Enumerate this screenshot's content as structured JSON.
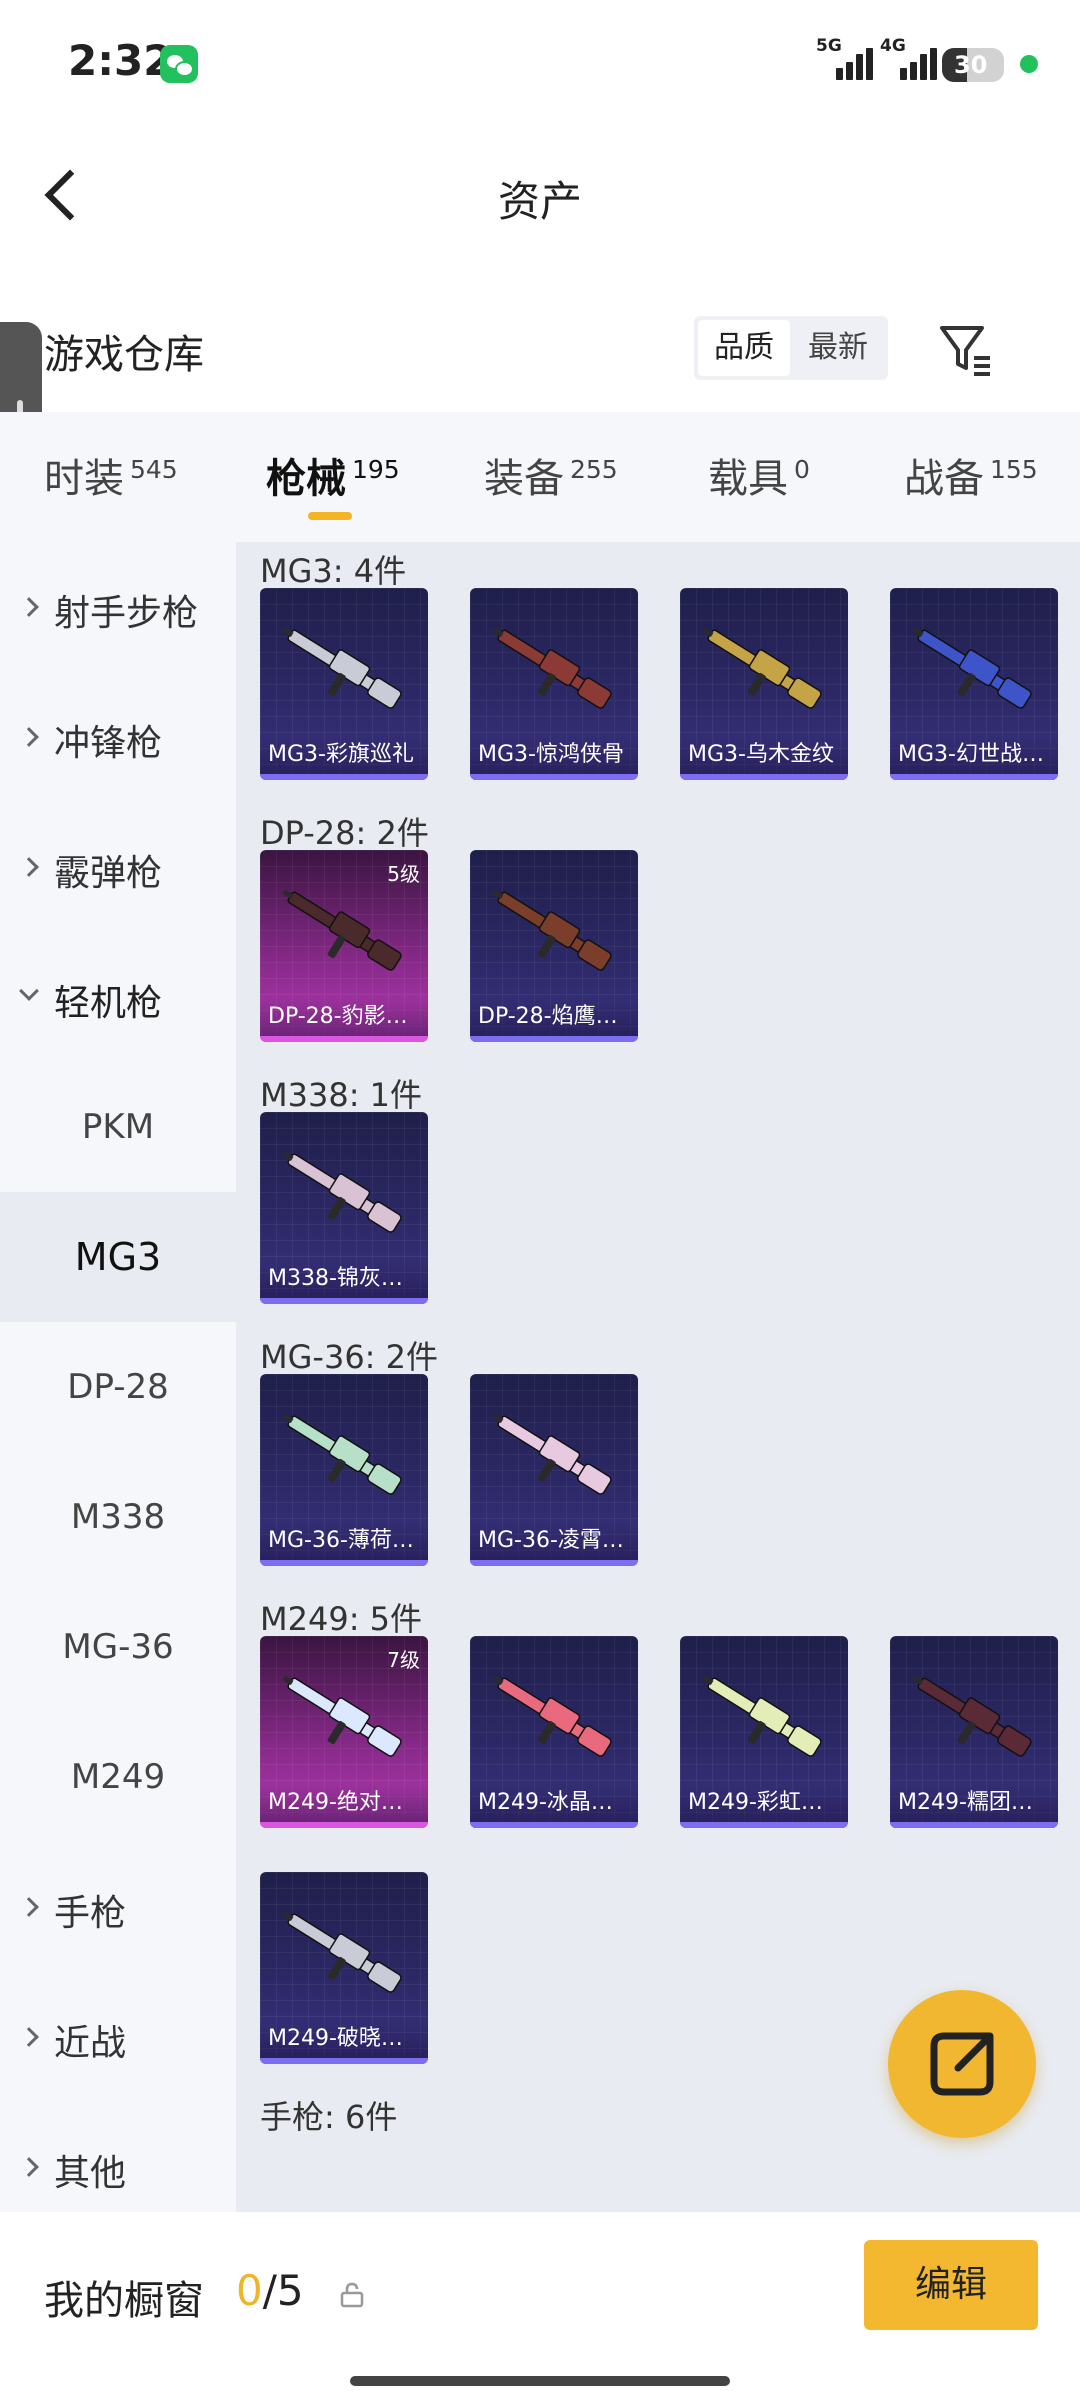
{
  "status_bar": {
    "time": "2:32",
    "signal1": "5G",
    "signal2": "4G",
    "battery": "30",
    "battery_level_pct": 30
  },
  "header": {
    "title": "资产"
  },
  "warehouse": {
    "title": "游戏仓库",
    "sort_options": [
      "品质",
      "最新"
    ],
    "active_sort": "品质"
  },
  "tabs": [
    {
      "label": "时装",
      "count": "545"
    },
    {
      "label": "枪械",
      "count": "195"
    },
    {
      "label": "装备",
      "count": "255"
    },
    {
      "label": "载具",
      "count": "0"
    },
    {
      "label": "战备",
      "count": "155"
    }
  ],
  "active_tab": "枪械",
  "sidebar": {
    "groups_before": [
      "射手步枪",
      "冲锋枪",
      "霰弹枪"
    ],
    "open_group": "轻机枪",
    "subitems": [
      "PKM",
      "MG3",
      "DP-28",
      "M338",
      "MG-36",
      "M249"
    ],
    "selected_subitem": "MG3",
    "groups_after": [
      "手枪",
      "近战",
      "其他"
    ]
  },
  "groups": [
    {
      "title": "MG3: 4件",
      "items": [
        {
          "name": "MG3-彩旗巡礼",
          "rarity": "blue"
        },
        {
          "name": "MG3-惊鸿侠骨",
          "rarity": "blue"
        },
        {
          "name": "MG3-乌木金纹",
          "rarity": "blue"
        },
        {
          "name": "MG3-幻世战…",
          "rarity": "blue"
        }
      ]
    },
    {
      "title": "DP-28: 2件",
      "items": [
        {
          "name": "DP-28-豹影…",
          "rarity": "purple",
          "level": "5级"
        },
        {
          "name": "DP-28-焰鹰…",
          "rarity": "blue"
        }
      ]
    },
    {
      "title": "M338: 1件",
      "items": [
        {
          "name": "M338-锦灰…",
          "rarity": "blue"
        }
      ]
    },
    {
      "title": "MG-36: 2件",
      "items": [
        {
          "name": "MG-36-薄荷…",
          "rarity": "blue"
        },
        {
          "name": "MG-36-凌霄…",
          "rarity": "blue"
        }
      ]
    },
    {
      "title": "M249: 5件",
      "items": [
        {
          "name": "M249-绝对…",
          "rarity": "purple",
          "level": "7级"
        },
        {
          "name": "M249-冰晶…",
          "rarity": "blue"
        },
        {
          "name": "M249-彩虹…",
          "rarity": "blue"
        },
        {
          "name": "M249-糯团…",
          "rarity": "blue"
        },
        {
          "name": "M249-破晓…",
          "rarity": "blue"
        }
      ]
    },
    {
      "title": "手枪: 6件",
      "items": []
    }
  ],
  "bottom": {
    "showcase_label": "我的橱窗",
    "showcase_current": "0",
    "showcase_total": "/5",
    "edit_label": "编辑"
  },
  "colors": {
    "accent": "#f3b82f",
    "card_blue": "#2c2866",
    "card_purple": "#8a2a8c"
  },
  "icons": {
    "back": "back-arrow-icon",
    "filter": "filter-icon",
    "share": "share-external-icon",
    "lock": "lock-icon",
    "chat": "wechat-icon"
  }
}
